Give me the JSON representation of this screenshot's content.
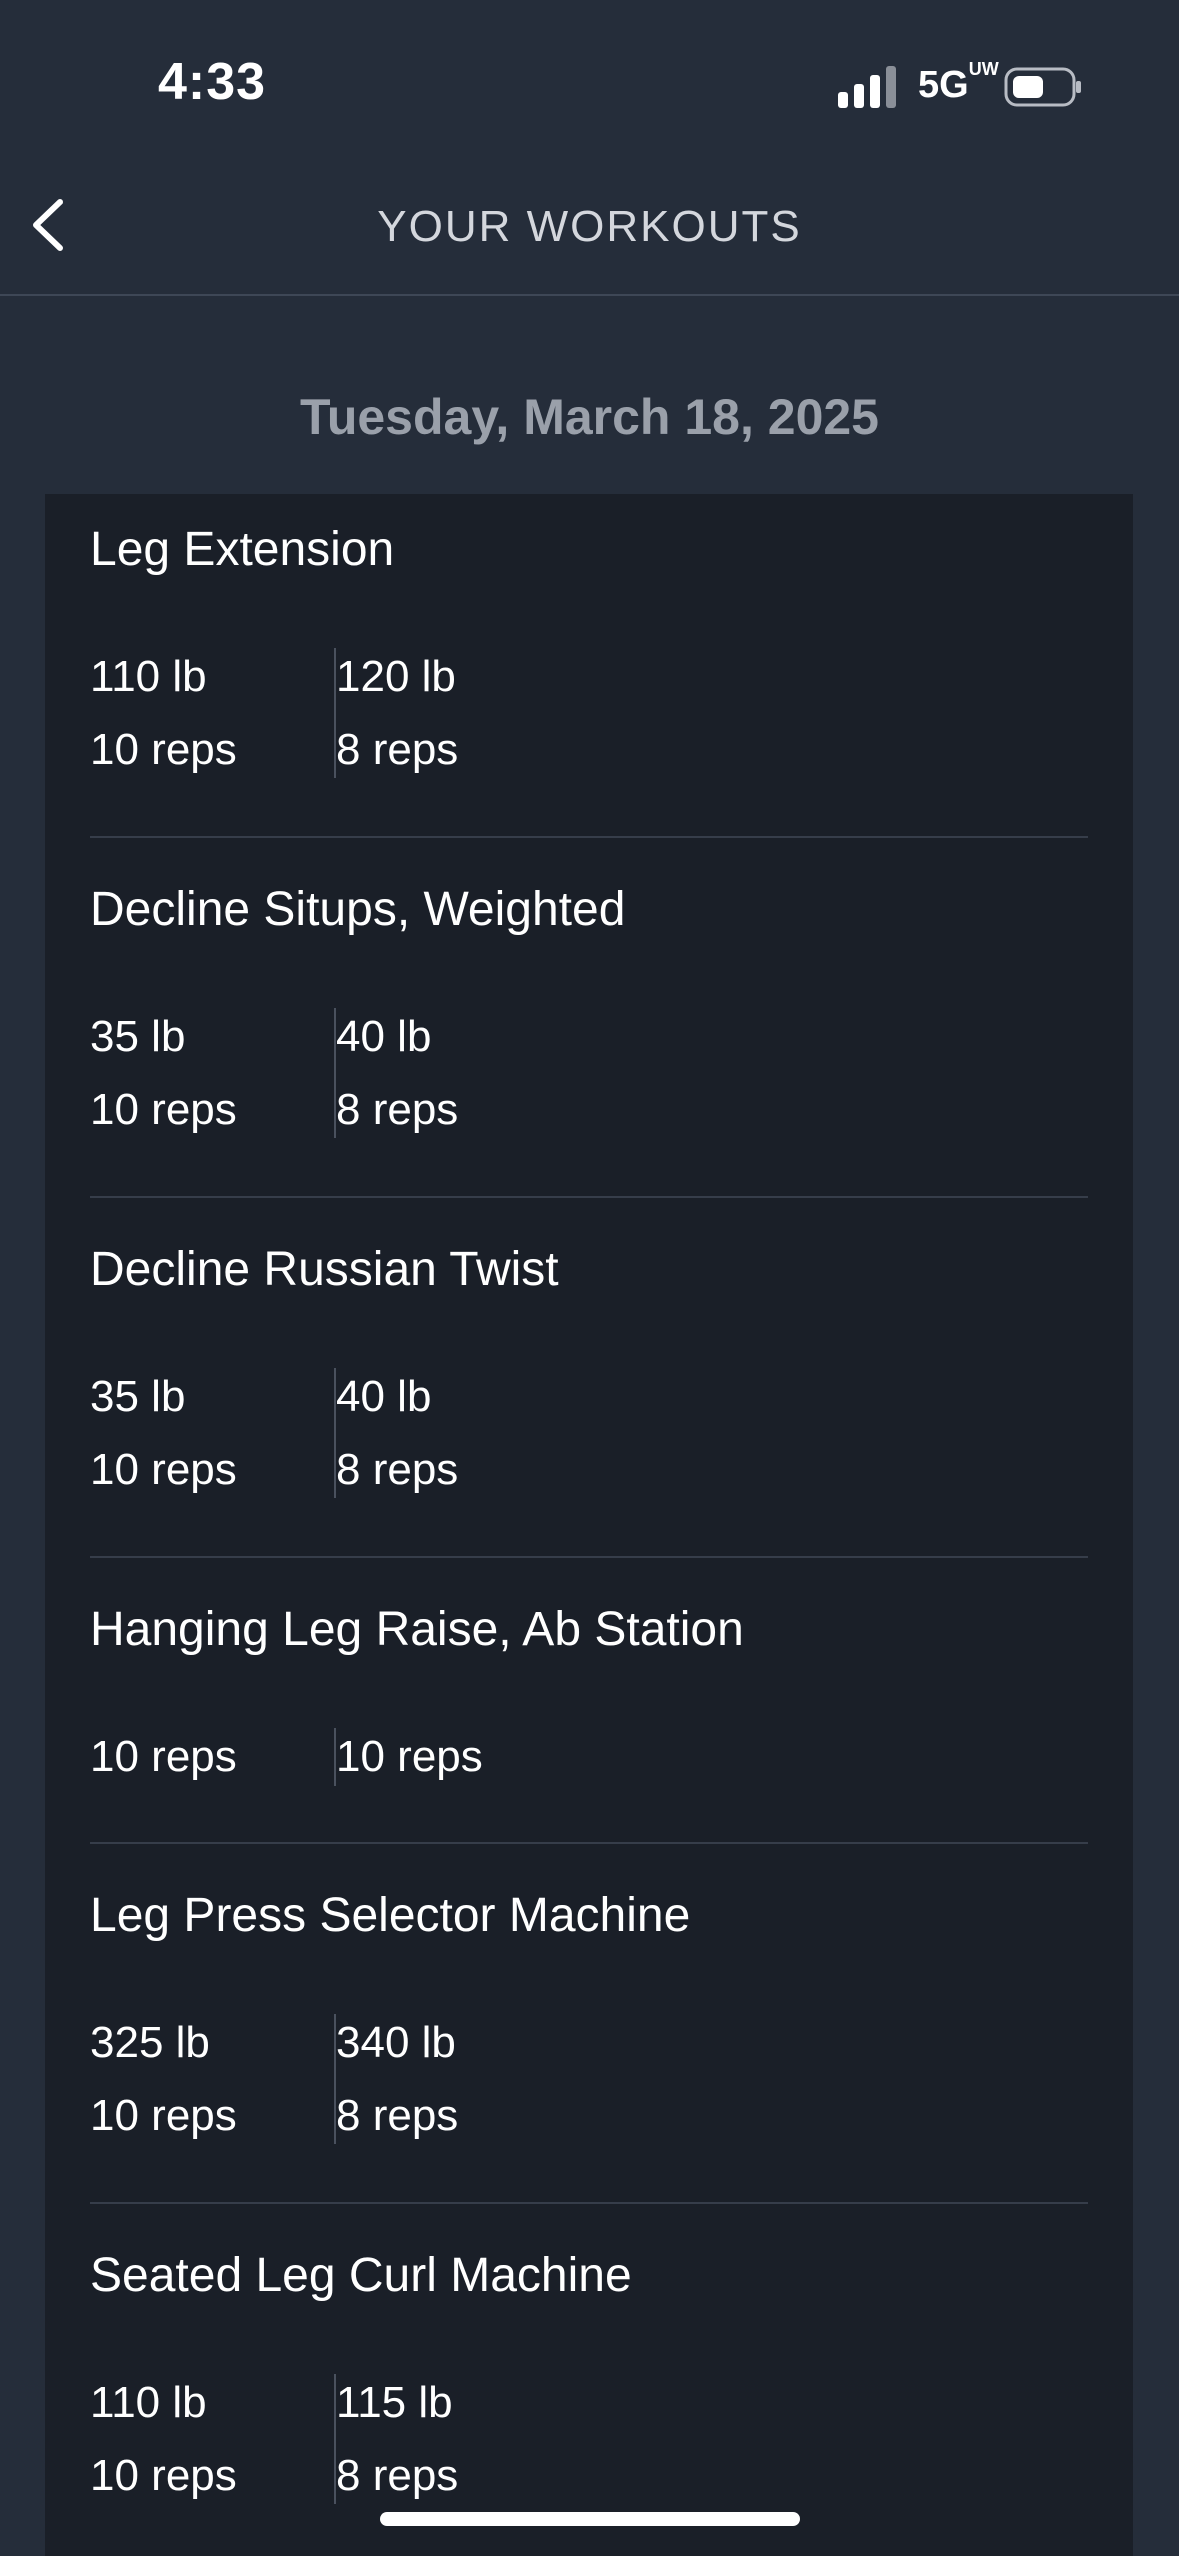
{
  "status_bar": {
    "time": "4:33",
    "network": "5G",
    "network_suffix": "UW"
  },
  "nav": {
    "title": "YOUR WORKOUTS"
  },
  "date": "Tuesday, March 18, 2025",
  "exercises": [
    {
      "name": "Leg Extension",
      "sets": [
        {
          "weight": "110 lb",
          "reps": "10 reps"
        },
        {
          "weight": "120 lb",
          "reps": "8 reps"
        }
      ]
    },
    {
      "name": "Decline Situps, Weighted",
      "sets": [
        {
          "weight": "35 lb",
          "reps": "10 reps"
        },
        {
          "weight": "40 lb",
          "reps": "8 reps"
        }
      ]
    },
    {
      "name": "Decline Russian Twist",
      "sets": [
        {
          "weight": "35 lb",
          "reps": "10 reps"
        },
        {
          "weight": "40 lb",
          "reps": "8 reps"
        }
      ]
    },
    {
      "name": "Hanging Leg Raise, Ab Station",
      "sets": [
        {
          "reps": "10 reps"
        },
        {
          "reps": "10 reps"
        }
      ]
    },
    {
      "name": "Leg Press Selector Machine",
      "sets": [
        {
          "weight": "325 lb",
          "reps": "10 reps"
        },
        {
          "weight": "340 lb",
          "reps": "8 reps"
        }
      ]
    },
    {
      "name": "Seated Leg Curl Machine",
      "sets": [
        {
          "weight": "110 lb",
          "reps": "10 reps"
        },
        {
          "weight": "115 lb",
          "reps": "8 reps"
        }
      ]
    }
  ]
}
